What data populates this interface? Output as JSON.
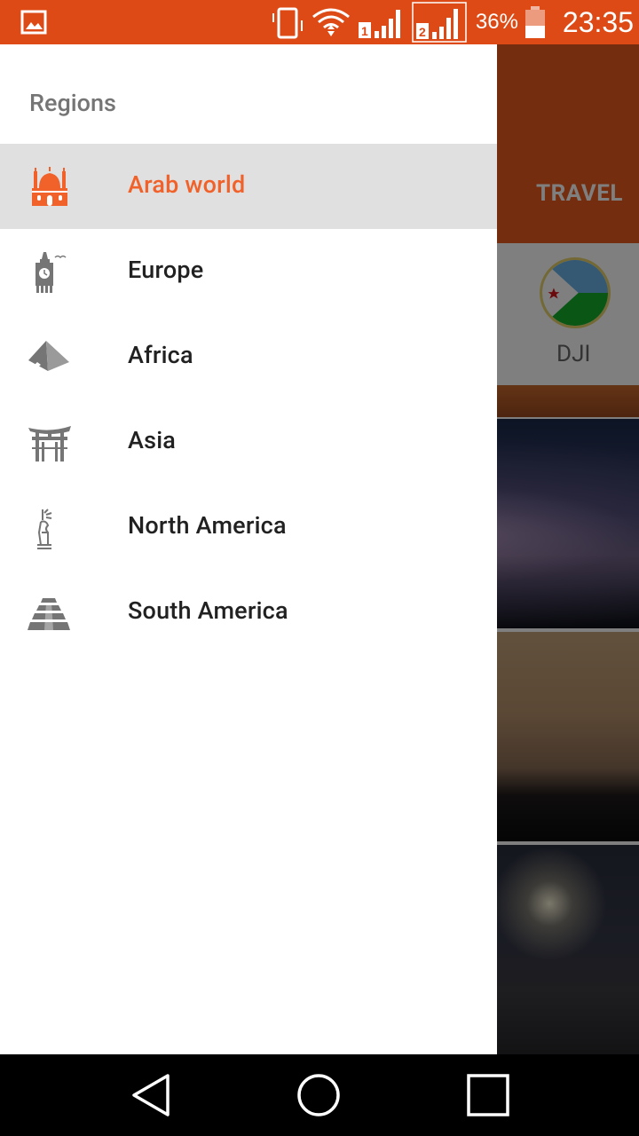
{
  "status_bar": {
    "battery_percent": "36%",
    "time": "23:35",
    "bg_color": "#dd4a16"
  },
  "background_app": {
    "tab_label": "TRAVEL",
    "country_label": "DJI",
    "toolbar_color": "#e85a1c"
  },
  "drawer": {
    "header": "Regions",
    "accent_color": "#f1612a",
    "items": [
      {
        "label": "Arab world",
        "icon": "mosque-icon",
        "active": true
      },
      {
        "label": "Europe",
        "icon": "big-ben-icon",
        "active": false
      },
      {
        "label": "Africa",
        "icon": "pyramid-icon",
        "active": false
      },
      {
        "label": "Asia",
        "icon": "torii-gate-icon",
        "active": false
      },
      {
        "label": "North America",
        "icon": "statue-of-liberty-icon",
        "active": false
      },
      {
        "label": "South America",
        "icon": "mayan-pyramid-icon",
        "active": false
      }
    ]
  },
  "nav_bar": {
    "back": "back-icon",
    "home": "home-icon",
    "recents": "recents-icon"
  }
}
